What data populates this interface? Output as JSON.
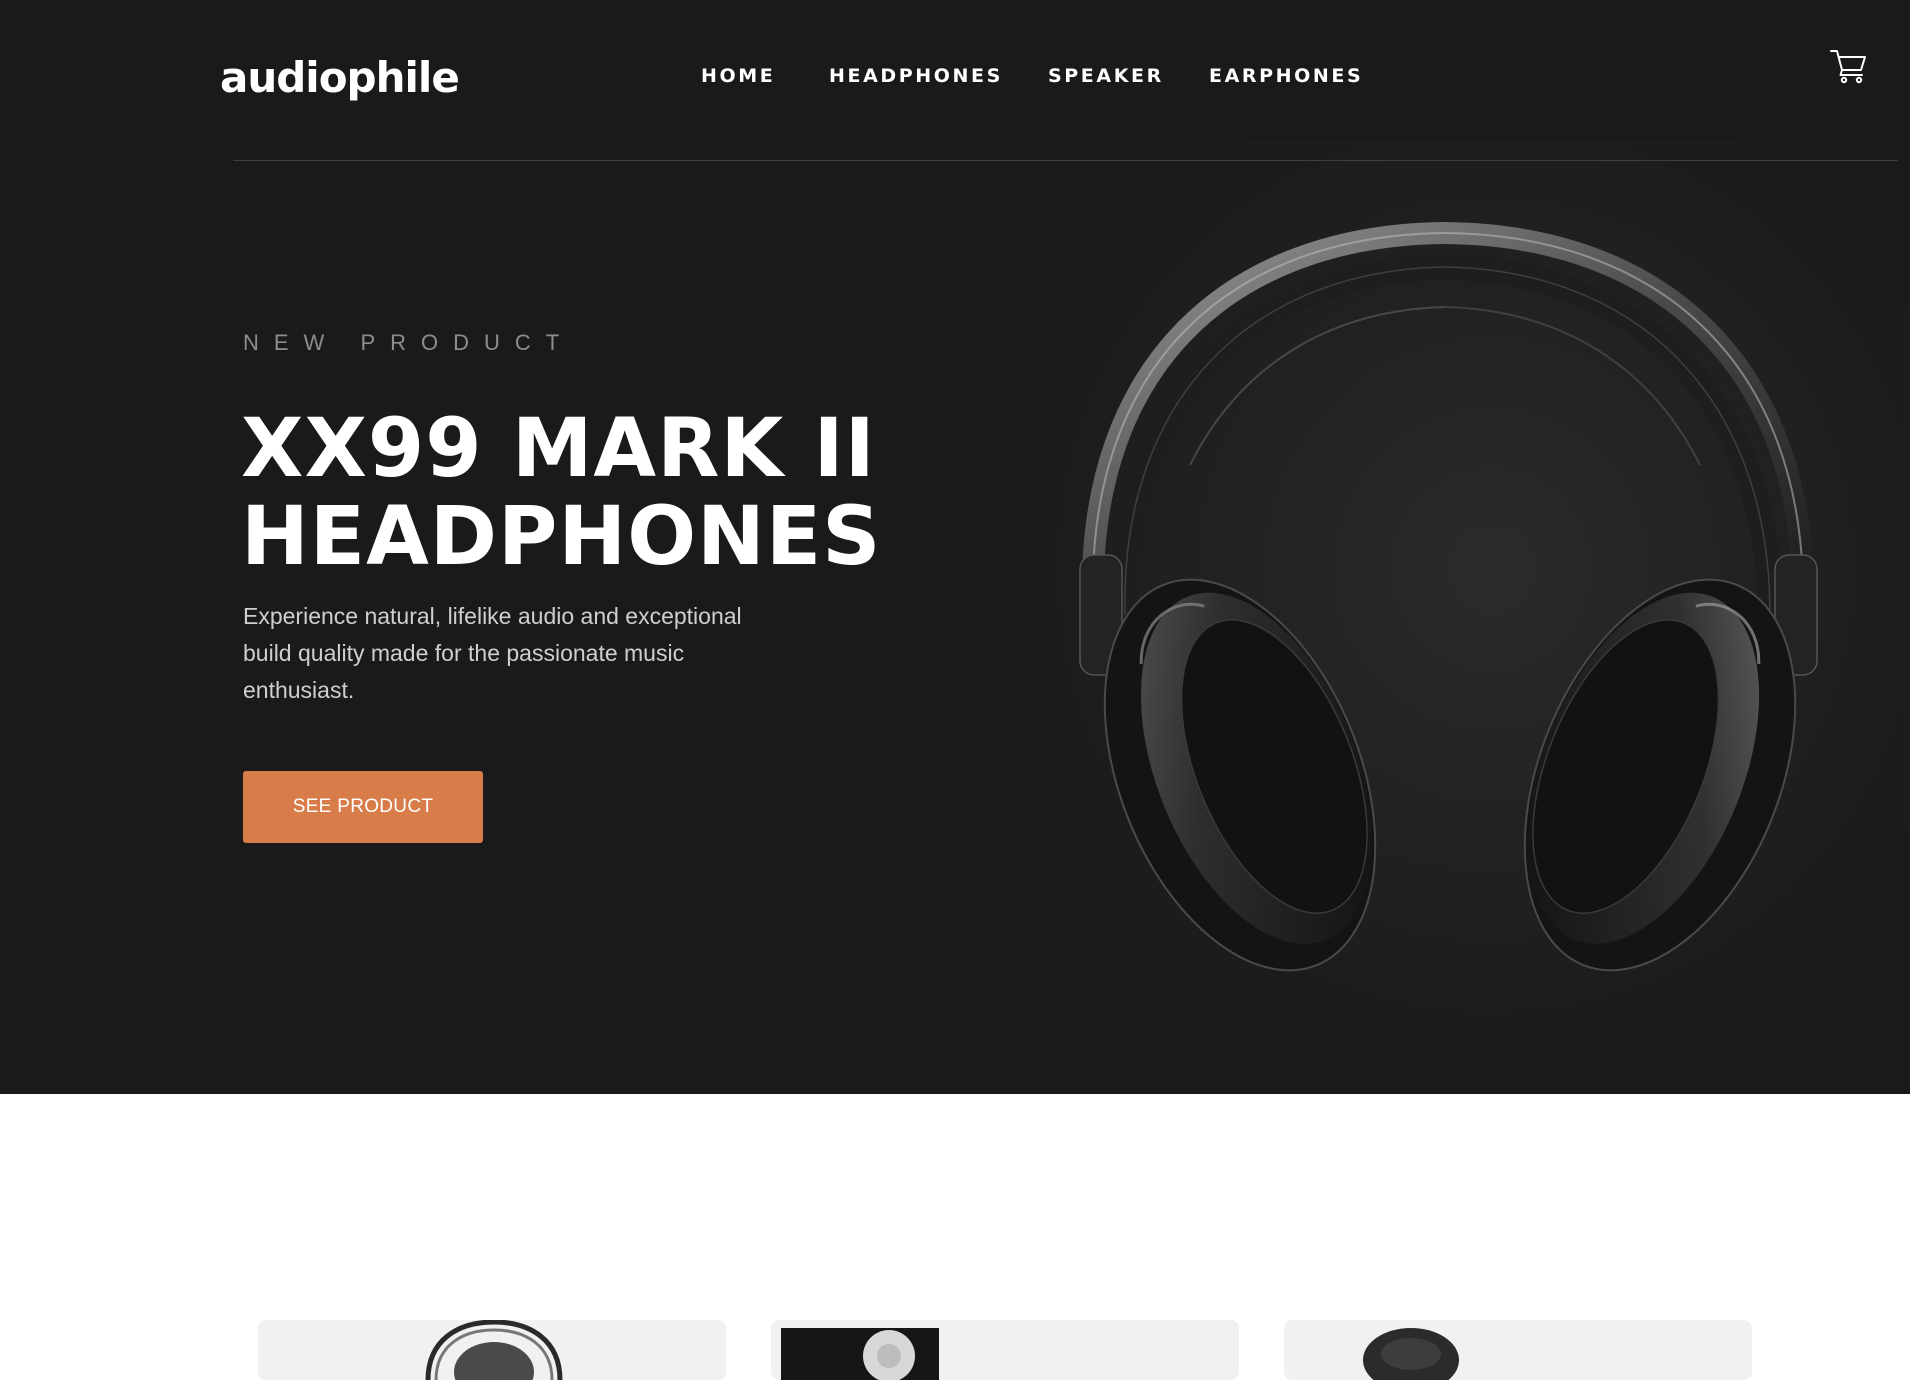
{
  "header": {
    "logo": "audiophile",
    "nav": [
      {
        "label": "HOME"
      },
      {
        "label": "HEADPHONES"
      },
      {
        "label": "SPEAKER"
      },
      {
        "label": "EARPHONES"
      }
    ],
    "cart_icon": "cart-icon"
  },
  "hero": {
    "overline": "NEW PRODUCT",
    "title_line_1": "XX99 MARK II",
    "title_line_2": "HEADPHONES",
    "description": "Experience natural, lifelike audio and exceptional build quality made for the passionate music enthusiast.",
    "cta_label": "SEE PRODUCT",
    "image_icon": "headphones-image"
  },
  "categories": [
    {
      "image_icon": "headphones-thumbnail"
    },
    {
      "image_icon": "speaker-thumbnail"
    },
    {
      "image_icon": "earphones-thumbnail"
    }
  ],
  "colors": {
    "hero_background": "#1a1a1b",
    "accent": "#d87d4a",
    "card_background": "#f1f1f1"
  }
}
